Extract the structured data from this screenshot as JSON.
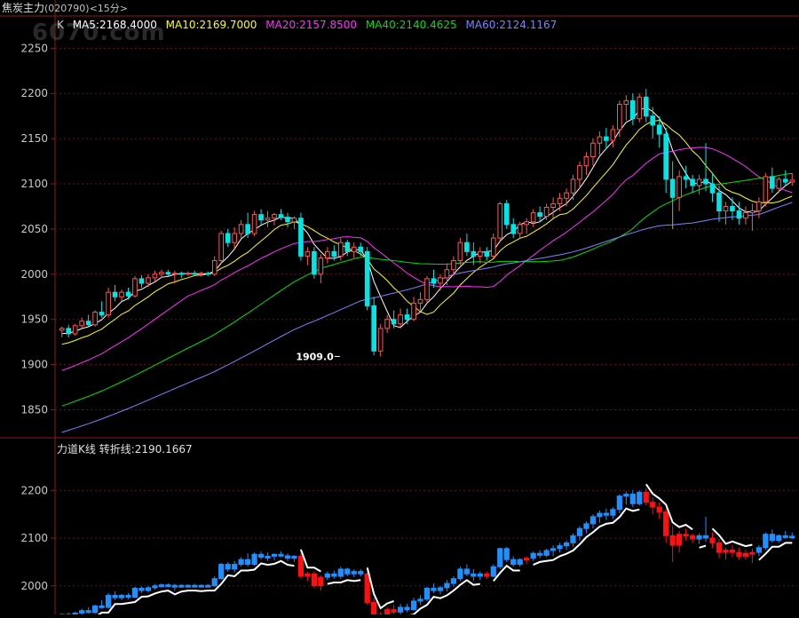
{
  "header": {
    "name": "焦炭主力",
    "code": "(020790)",
    "period": "<15分>"
  },
  "watermark": "6070.com",
  "colors": {
    "background": "#000000",
    "axis": "#8b1a1a",
    "grid": "#6b1111",
    "up_candle": "#ff5555",
    "down_candle": "#00e5e5",
    "ma5": "#ffffff",
    "ma10": "#ffff00",
    "ma20": "#ff30ff",
    "ma40": "#00e000",
    "ma60": "#8080ff",
    "lidao_up": "#1e90ff",
    "lidao_down": "#ff1010",
    "turn_line": "#ffffff"
  },
  "chart_data": [
    {
      "type": "candlestick",
      "legend": {
        "prefix": "K",
        "ma5": "MA5:2168.4000",
        "ma10": "MA10:2169.7000",
        "ma20": "MA20:2157.8500",
        "ma40": "MA40:2140.4625",
        "ma60": "MA60:2124.1167"
      },
      "ylim": [
        1820,
        2270
      ],
      "yticks": [
        1850,
        1900,
        1950,
        2000,
        2050,
        2100,
        2150,
        2200,
        2250
      ],
      "low_annotation": {
        "label": "1909.0",
        "value": 1909.0,
        "index": 42
      },
      "ohlc": [
        [
          1938,
          1942,
          1930,
          1940
        ],
        [
          1940,
          1944,
          1930,
          1934
        ],
        [
          1934,
          1945,
          1932,
          1943
        ],
        [
          1943,
          1952,
          1940,
          1948
        ],
        [
          1948,
          1955,
          1942,
          1944
        ],
        [
          1944,
          1960,
          1942,
          1958
        ],
        [
          1958,
          1970,
          1952,
          1955
        ],
        [
          1955,
          1985,
          1952,
          1980
        ],
        [
          1980,
          1988,
          1970,
          1975
        ],
        [
          1975,
          1983,
          1970,
          1980
        ],
        [
          1980,
          1985,
          1972,
          1976
        ],
        [
          1976,
          1998,
          1974,
          1995
        ],
        [
          1995,
          1999,
          1985,
          1990
        ],
        [
          1990,
          2000,
          1986,
          1996
        ],
        [
          1996,
          2004,
          1992,
          2000
        ],
        [
          2000,
          2005,
          1996,
          2002
        ],
        [
          2002,
          2005,
          1998,
          2000
        ],
        [
          2000,
          2004,
          1990,
          2001
        ],
        [
          2001,
          2003,
          1996,
          2000
        ],
        [
          2000,
          2003,
          1998,
          2001
        ],
        [
          2001,
          2004,
          1998,
          2000
        ],
        [
          2000,
          2003,
          1997,
          2001
        ],
        [
          2001,
          2003,
          1998,
          2000
        ],
        [
          2000,
          2020,
          1998,
          2015
        ],
        [
          2015,
          2048,
          2012,
          2045
        ],
        [
          2045,
          2050,
          2030,
          2035
        ],
        [
          2035,
          2052,
          2028,
          2045
        ],
        [
          2045,
          2060,
          2040,
          2055
        ],
        [
          2055,
          2068,
          2040,
          2045
        ],
        [
          2045,
          2070,
          2042,
          2066
        ],
        [
          2066,
          2072,
          2055,
          2060
        ],
        [
          2060,
          2070,
          2052,
          2062
        ],
        [
          2062,
          2068,
          2054,
          2066
        ],
        [
          2066,
          2072,
          2060,
          2063
        ],
        [
          2063,
          2068,
          2052,
          2058
        ],
        [
          2058,
          2064,
          2050,
          2062
        ],
        [
          2062,
          2068,
          2015,
          2020
        ],
        [
          2020,
          2030,
          2010,
          2025
        ],
        [
          2025,
          2030,
          1995,
          2000
        ],
        [
          2000,
          2022,
          1990,
          2018
        ],
        [
          2018,
          2030,
          2012,
          2025
        ],
        [
          2025,
          2032,
          2015,
          2020
        ],
        [
          2020,
          2040,
          2015,
          2035
        ],
        [
          2035,
          2038,
          2020,
          2025
        ],
        [
          2025,
          2035,
          2018,
          2030
        ],
        [
          2030,
          2035,
          2020,
          2025
        ],
        [
          2025,
          2030,
          1960,
          1965
        ],
        [
          1965,
          1975,
          1910,
          1915
        ],
        [
          1915,
          1945,
          1909,
          1940
        ],
        [
          1940,
          1955,
          1935,
          1950
        ],
        [
          1950,
          1960,
          1940,
          1945
        ],
        [
          1945,
          1962,
          1940,
          1955
        ],
        [
          1955,
          1962,
          1945,
          1950
        ],
        [
          1950,
          1975,
          1948,
          1968
        ],
        [
          1968,
          1980,
          1960,
          1972
        ],
        [
          1972,
          1998,
          1968,
          1995
        ],
        [
          1995,
          2005,
          1985,
          1990
        ],
        [
          1990,
          2000,
          1982,
          1996
        ],
        [
          1996,
          2012,
          1988,
          2005
        ],
        [
          2005,
          2020,
          1998,
          2015
        ],
        [
          2015,
          2040,
          2010,
          2035
        ],
        [
          2035,
          2045,
          2020,
          2025
        ],
        [
          2025,
          2035,
          2010,
          2020
        ],
        [
          2020,
          2030,
          2012,
          2025
        ],
        [
          2025,
          2030,
          2015,
          2020
        ],
        [
          2020,
          2045,
          2018,
          2040
        ],
        [
          2040,
          2080,
          2035,
          2078
        ],
        [
          2078,
          2082,
          2050,
          2055
        ],
        [
          2055,
          2062,
          2040,
          2045
        ],
        [
          2045,
          2058,
          2040,
          2055
        ],
        [
          2055,
          2062,
          2045,
          2058
        ],
        [
          2058,
          2072,
          2052,
          2068
        ],
        [
          2068,
          2075,
          2058,
          2064
        ],
        [
          2064,
          2078,
          2060,
          2074
        ],
        [
          2074,
          2085,
          2062,
          2078
        ],
        [
          2078,
          2090,
          2070,
          2084
        ],
        [
          2084,
          2095,
          2075,
          2090
        ],
        [
          2090,
          2110,
          2082,
          2105
        ],
        [
          2105,
          2125,
          2095,
          2120
        ],
        [
          2120,
          2135,
          2110,
          2130
        ],
        [
          2130,
          2150,
          2120,
          2145
        ],
        [
          2145,
          2158,
          2132,
          2152
        ],
        [
          2152,
          2162,
          2138,
          2148
        ],
        [
          2148,
          2165,
          2140,
          2160
        ],
        [
          2160,
          2192,
          2152,
          2188
        ],
        [
          2188,
          2198,
          2170,
          2192
        ],
        [
          2192,
          2200,
          2165,
          2172
        ],
        [
          2172,
          2200,
          2168,
          2196
        ],
        [
          2196,
          2205,
          2168,
          2175
        ],
        [
          2175,
          2185,
          2150,
          2165
        ],
        [
          2165,
          2175,
          2140,
          2155
        ],
        [
          2155,
          2162,
          2090,
          2105
        ],
        [
          2105,
          2125,
          2050,
          2085
        ],
        [
          2085,
          2115,
          2070,
          2108
        ],
        [
          2108,
          2120,
          2095,
          2105
        ],
        [
          2105,
          2110,
          2090,
          2098
        ],
        [
          2098,
          2110,
          2088,
          2105
        ],
        [
          2105,
          2145,
          2092,
          2100
        ],
        [
          2100,
          2112,
          2080,
          2090
        ],
        [
          2090,
          2098,
          2058,
          2070
        ],
        [
          2070,
          2080,
          2055,
          2075
        ],
        [
          2075,
          2085,
          2060,
          2070
        ],
        [
          2070,
          2080,
          2055,
          2062
        ],
        [
          2062,
          2075,
          2055,
          2068
        ],
        [
          2068,
          2078,
          2048,
          2070
        ],
        [
          2070,
          2085,
          2062,
          2080
        ],
        [
          2080,
          2112,
          2075,
          2108
        ],
        [
          2108,
          2118,
          2090,
          2095
        ],
        [
          2095,
          2108,
          2090,
          2105
        ],
        [
          2105,
          2115,
          2098,
          2102
        ],
        [
          2102,
          2112,
          2098,
          2104
        ]
      ]
    },
    {
      "type": "candlestick",
      "legend": {
        "title": "力道K线",
        "turn": "转折线:2190.1667"
      },
      "ylim": [
        1940,
        2260
      ],
      "yticks": [
        2000,
        2100,
        2200
      ]
    }
  ]
}
